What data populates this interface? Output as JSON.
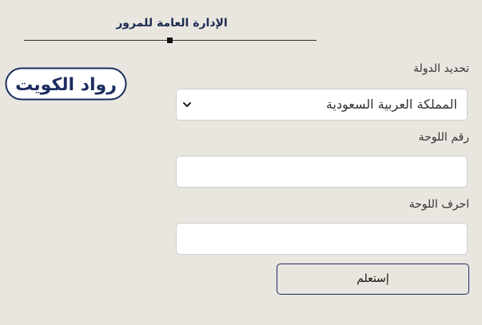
{
  "header": {
    "title": "الإدارة العامة للمرور"
  },
  "logo": {
    "text": "رواد الكويت",
    "colors": {
      "accent": "#1c2c5e",
      "border": "#1c2c5e"
    }
  },
  "form": {
    "country_label": "تحديد الدولة",
    "country_selected": "المملكة العربية السعودية",
    "plate_number_label": "رقم اللوحة",
    "plate_number_value": "",
    "plate_letters_label": "احرف اللوحة",
    "plate_letters_value": "",
    "submit_label": "إستعلم"
  },
  "colors": {
    "background": "#e9e6df",
    "title": "#1a2a52",
    "button_border": "#1c2c5e"
  },
  "icons": {
    "select_arrow": "chevron-down-icon"
  }
}
